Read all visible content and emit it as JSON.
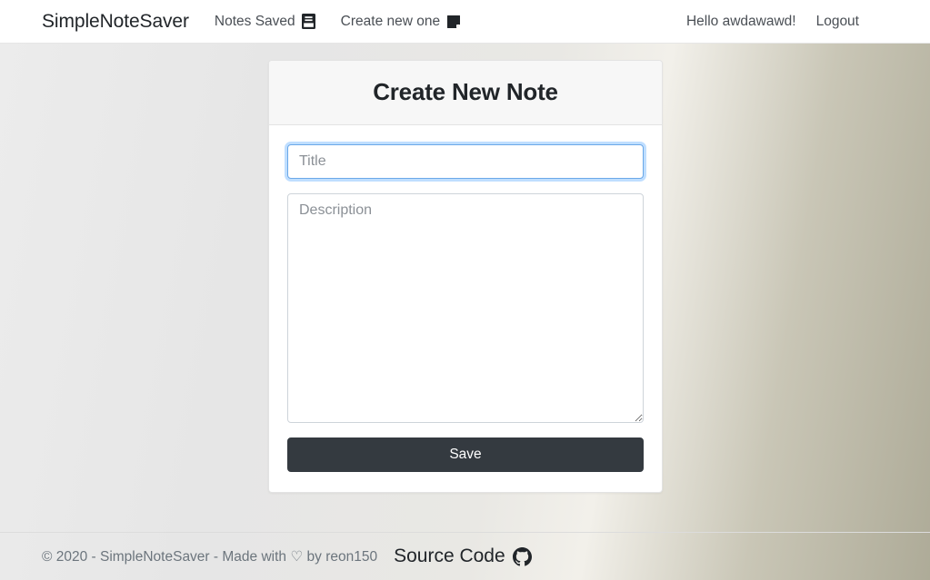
{
  "navbar": {
    "brand": "SimpleNoteSaver",
    "links": [
      {
        "label": "Notes Saved",
        "icon": "journal-icon"
      },
      {
        "label": "Create new one",
        "icon": "sticky-note-icon"
      }
    ],
    "greeting": "Hello awdawawd!",
    "logout": "Logout"
  },
  "card": {
    "title": "Create New Note",
    "title_input": {
      "placeholder": "Title",
      "value": ""
    },
    "description_input": {
      "placeholder": "Description",
      "value": ""
    },
    "save_label": "Save"
  },
  "footer": {
    "copyright": "© 2020 - SimpleNoteSaver - Made with ♡ by reon150",
    "source_label": "Source Code",
    "source_icon": "github-icon"
  },
  "colors": {
    "button": "#343a40",
    "focus_border": "#6ba8e8",
    "focus_glow": "rgba(0,123,255,0.25)",
    "card_header_bg": "#f7f7f7",
    "muted_text": "#6c757d",
    "background_gradient_start": "#ececec",
    "background_gradient_end": "#aeab98"
  }
}
